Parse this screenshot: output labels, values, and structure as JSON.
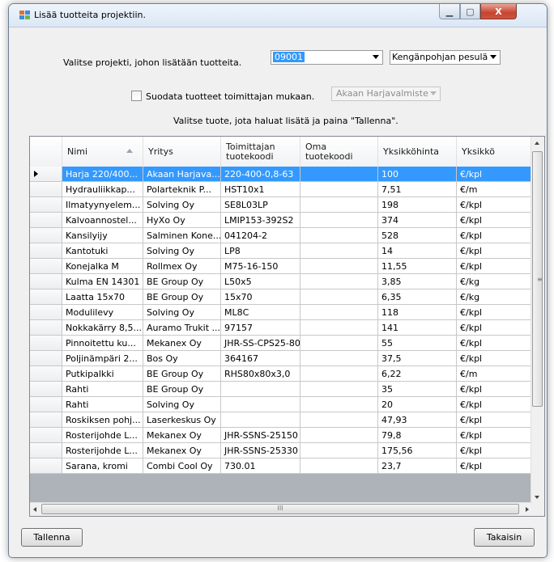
{
  "window": {
    "title": "Lisää tuotteita projektiin."
  },
  "titlebar_buttons": {
    "minimize": "▁",
    "maximize": "▢",
    "close": "X"
  },
  "project": {
    "label": "Valitse projekti, johon lisätään tuotteita.",
    "number_value": "09001",
    "name_value": "Kengänpohjan pesulä"
  },
  "filter": {
    "label": "Suodata tuotteet toimittajan mukaan.",
    "checked": false,
    "supplier_value": "Akaan Harjavalmiste"
  },
  "instruction": "Valitse tuote, jota haluat lisätä ja paina \"Tallenna\".",
  "grid": {
    "columns": [
      "Nimi",
      "Yritys",
      "Toimittajan\ntuotekoodi",
      "Oma\ntuotekoodi",
      "Yksikköhinta",
      "Yksikkö"
    ],
    "rows": [
      [
        "Harja 220/400...",
        "Akaan Harjava...",
        "220-400-0,8-63",
        "",
        "100",
        "€/kpl"
      ],
      [
        "Hydrauliikkap...",
        "Polarteknik P...",
        "HST10x1",
        "",
        "7,51",
        "€/m"
      ],
      [
        "Ilmatyynyelem...",
        "Solving Oy",
        "SE8L03LP",
        "",
        "198",
        "€/kpl"
      ],
      [
        "Kalvoannostel...",
        "HyXo Oy",
        "LMIP153-392S2",
        "",
        "374",
        "€/kpl"
      ],
      [
        "Kansilyijy",
        "Salminen Kone...",
        "041204-2",
        "",
        "528",
        "€/kpl"
      ],
      [
        "Kantotuki",
        "Solving Oy",
        "LP8",
        "",
        "14",
        "€/kpl"
      ],
      [
        "Konejalka M",
        "Rollmex Oy",
        "M75-16-150",
        "",
        "11,55",
        "€/kpl"
      ],
      [
        "Kulma EN 14301",
        "BE Group Oy",
        "L50x5",
        "",
        "3,85",
        "€/kg"
      ],
      [
        "Laatta 15x70",
        "BE Group Oy",
        "15x70",
        "",
        "6,35",
        "€/kg"
      ],
      [
        "Modulilevy",
        "Solving Oy",
        "ML8C",
        "",
        "118",
        "€/kpl"
      ],
      [
        "Nokkakärry 8,5...",
        "Auramo Trukit ...",
        "97157",
        "",
        "141",
        "€/kpl"
      ],
      [
        "Pinnoitettu ku...",
        "Mekanex Oy",
        "JHR-SS-CPS25-80",
        "",
        "55",
        "€/kpl"
      ],
      [
        "Poljinämpäri 2...",
        "Bos Oy",
        "364167",
        "",
        "37,5",
        "€/kpl"
      ],
      [
        "Putkipalkki",
        "BE Group Oy",
        "RHS80x80x3,0",
        "",
        "6,22",
        "€/m"
      ],
      [
        "Rahti",
        "BE Group Oy",
        "",
        "",
        "35",
        "€/kpl"
      ],
      [
        "Rahti",
        "Solving Oy",
        "",
        "",
        "20",
        "€/kpl"
      ],
      [
        "Roskiksen pohj...",
        "Laserkeskus Oy",
        "",
        "",
        "47,93",
        "€/kpl"
      ],
      [
        "Rosterijohde L...",
        "Mekanex Oy",
        "JHR-SSNS-25150",
        "",
        "79,8",
        "€/kpl"
      ],
      [
        "Rosterijohde L...",
        "Mekanex Oy",
        "JHR-SSNS-25330",
        "",
        "175,56",
        "€/kpl"
      ],
      [
        "Sarana, kromi",
        "Combi Cool Oy",
        "730.01",
        "",
        "23,7",
        "€/kpl"
      ]
    ],
    "selected_row": 0,
    "hscroll_grip": "III",
    "vscroll_grip": "≡"
  },
  "buttons": {
    "save": "Tallenna",
    "back": "Takaisin"
  },
  "colors": {
    "selection": "#3399ff",
    "grid_background": "#aeb3ba"
  }
}
